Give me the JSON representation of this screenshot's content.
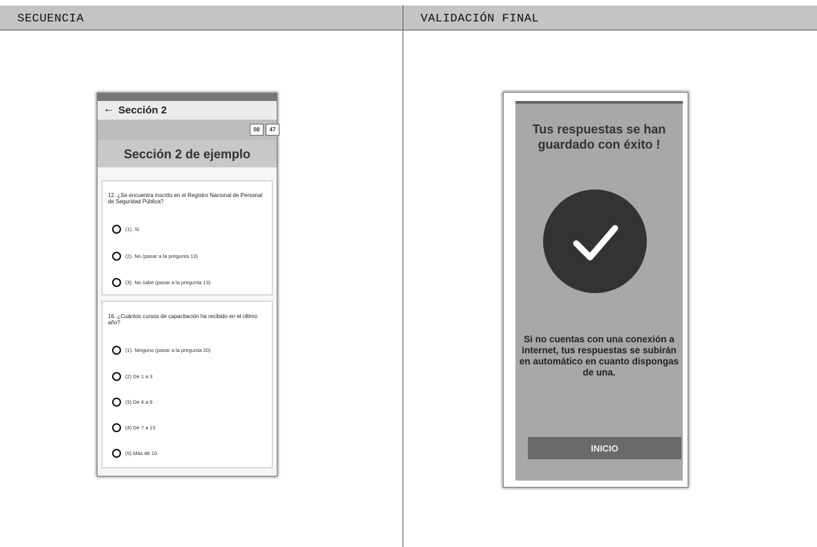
{
  "table": {
    "headers": [
      "SECUENCIA",
      "VALIDACIÓN FINAL"
    ]
  },
  "left_phone": {
    "app_title": "Sección 2",
    "timer": [
      "08",
      "47"
    ],
    "section_banner": "Sección 2 de ejemplo",
    "questions": [
      {
        "text": "12. ¿Se encuentra inscrito en el Registro Nacional de Personal de Seguridad Pública?",
        "options": [
          "(1). Si",
          "(2). No (pasar a la pregunta 13)",
          "(3). No sabe (pasar a la pregunta 13)"
        ]
      },
      {
        "text": "16. ¿Cuántos cursos de capacitación ha recibido en el último año?",
        "options": [
          "(1). Ninguno (pasar a la pregunta 20)",
          "(2) De 1 a 3",
          "(3) De 4 a 6",
          "(4) De 7 a 10",
          "(5) Más de 10"
        ]
      }
    ]
  },
  "right_phone": {
    "title": "Tus respuestas se han guardado con éxito !",
    "info": "Si no cuentas con una conexión a internet, tus respuestas se subirán en automático en cuanto dispongas de una.",
    "button_label": "INICIO",
    "icon": "checkmark-icon"
  }
}
